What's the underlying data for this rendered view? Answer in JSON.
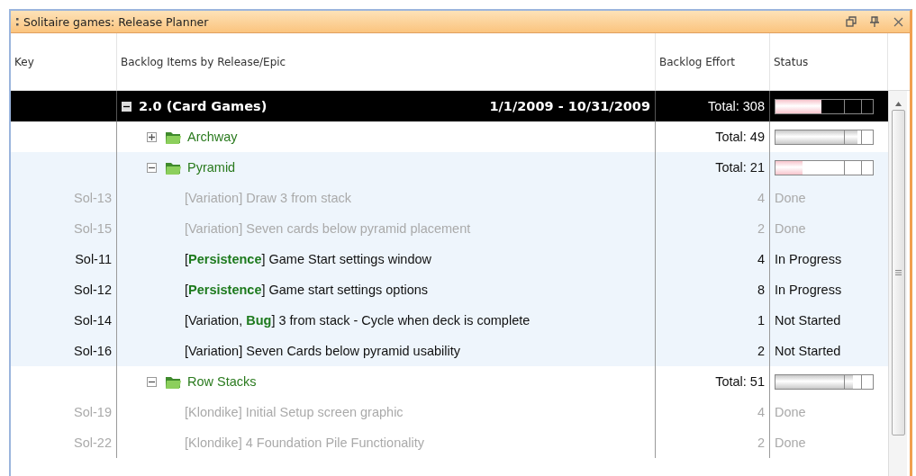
{
  "window": {
    "title": "Solitaire games: Release Planner"
  },
  "columns": [
    "Key",
    "Backlog Items by Release/Epic",
    "Backlog Effort",
    "Status"
  ],
  "releases": [
    {
      "name": "2.0 (Card Games)",
      "dates": "1/1/2009 - 10/31/2009",
      "effort": "Total: 308",
      "expanded": true,
      "status_bar": {
        "level": 0.47,
        "color": "#f7c4cc"
      },
      "children": [
        {
          "name": "Archway",
          "expanded": false,
          "selected": false,
          "effort": "Total: 49",
          "status_bar": {
            "level": 0.84,
            "color": "#c8c8c8"
          }
        },
        {
          "name": "Pyramid",
          "expanded": true,
          "selected": true,
          "effort": "Total: 21",
          "status_bar": {
            "level": 0.28,
            "color": "#f7c4cc"
          },
          "children": [
            {
              "key": "Sol-13",
              "title": "[Variation] Draw 3 from stack",
              "effort": "4",
              "status": "Done",
              "dimmed": true
            },
            {
              "key": "Sol-15",
              "title": "[Variation] Seven cards below pyramid placement",
              "effort": "2",
              "status": "Done",
              "dimmed": true
            },
            {
              "key": "Sol-11",
              "title": "[**Persistence**] Game Start settings window",
              "effort": "4",
              "status": "In Progress",
              "dimmed": false
            },
            {
              "key": "Sol-12",
              "title": "[**Persistence**] Game start settings options",
              "effort": "8",
              "status": "In Progress",
              "dimmed": false
            },
            {
              "key": "Sol-14",
              "title": "[Variation, **Bug**] 3 from stack - Cycle when deck is complete",
              "effort": "1",
              "status": "Not Started",
              "dimmed": false
            },
            {
              "key": "Sol-16",
              "title": "[Variation] Seven Cards below pyramid usability",
              "effort": "2",
              "status": "Not Started",
              "dimmed": false
            }
          ]
        },
        {
          "name": "Row Stacks",
          "expanded": true,
          "selected": false,
          "effort": "Total: 51",
          "status_bar": {
            "level": 0.8,
            "color": "#c8c8c8"
          },
          "children": [
            {
              "key": "Sol-19",
              "title": "[Klondike] Initial Setup screen graphic",
              "effort": "4",
              "status": "Done",
              "dimmed": true
            },
            {
              "key": "Sol-22",
              "title": "[Klondike] 4 Foundation Pile Functionality",
              "effort": "2",
              "status": "Done",
              "dimmed": true
            }
          ]
        }
      ]
    }
  ]
}
